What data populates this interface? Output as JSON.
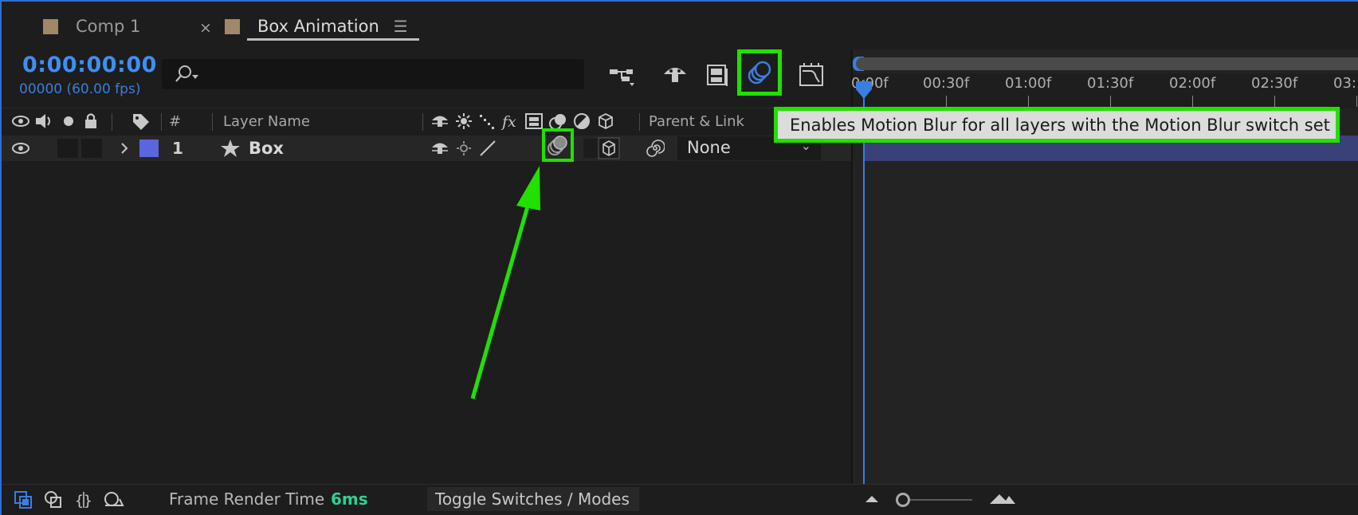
{
  "tabs": {
    "comp1_label": "Comp 1",
    "box_label": "Box Animation",
    "close_glyph": "×",
    "menu_glyph": "☰",
    "swatch_color": "#a08868"
  },
  "time": {
    "timecode": "0:00:00:00",
    "frames_fps": "00000 (60.00 fps)"
  },
  "search": {
    "placeholder": ""
  },
  "toolbar": {
    "icons": [
      "flowchart-icon",
      "shy-icon",
      "frame-blending-icon",
      "motion-blur-icon",
      "graph-editor-icon"
    ],
    "motion_blur_active": true,
    "highlight_color": "#22e000"
  },
  "columns": {
    "number": "#",
    "layer_name": "Layer Name",
    "parent_link": "Parent & Link"
  },
  "layer": {
    "number": "1",
    "name": "Box",
    "label_color": "#5a66e0",
    "parent": "None",
    "motion_blur_switch": "on"
  },
  "timeline": {
    "ruler_labels": [
      "0:00f",
      "00:30f",
      "01:00f",
      "01:30f",
      "02:00f",
      "02:30f",
      "03:"
    ],
    "accent_color": "#3a7ee0"
  },
  "tooltip": {
    "text": "Enables Motion Blur for all layers with the Motion Blur switch set"
  },
  "bottom": {
    "frame_render_label": "Frame Render Time",
    "frame_render_value": "6ms",
    "toggle_label": "Toggle Switches / Modes"
  }
}
